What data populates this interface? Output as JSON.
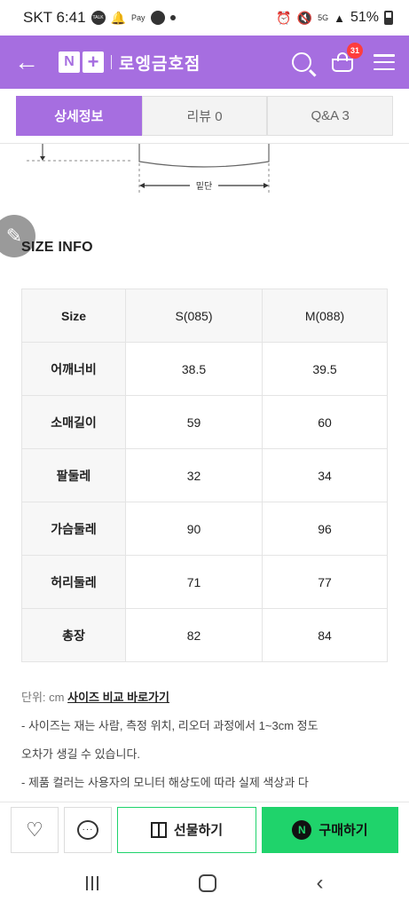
{
  "status_bar": {
    "carrier_time": "SKT 6:41",
    "talk_icon": "TALK",
    "pay_icon": "Pay",
    "network": "5G",
    "battery": "51%"
  },
  "header": {
    "logo_n": "N",
    "logo_plus": "+",
    "store_name": "로엥금호점",
    "cart_count": "31",
    "colors": {
      "brand": "#a66ee0",
      "badge": "#ff3d3d"
    }
  },
  "tabs": [
    {
      "label": "상세정보",
      "active": true
    },
    {
      "label": "리뷰 0",
      "active": false
    },
    {
      "label": "Q&A 3",
      "active": false
    }
  ],
  "diagram": {
    "label": "밑단"
  },
  "size_info": {
    "title": "SIZE INFO",
    "headers": [
      "Size",
      "S(085)",
      "M(088)"
    ],
    "rows": [
      {
        "name": "어깨너비",
        "s": "38.5",
        "m": "39.5"
      },
      {
        "name": "소매길이",
        "s": "59",
        "m": "60"
      },
      {
        "name": "팔둘레",
        "s": "32",
        "m": "34"
      },
      {
        "name": "가슴둘레",
        "s": "90",
        "m": "96"
      },
      {
        "name": "허리둘레",
        "s": "71",
        "m": "77"
      },
      {
        "name": "총장",
        "s": "82",
        "m": "84"
      }
    ]
  },
  "notes": {
    "unit_label": "단위: cm",
    "compare_link": "사이즈 비교 바로가기",
    "line1": "- 사이즈는 재는 사람, 측정 위치, 리오더 과정에서 1~3cm 정도",
    "line2": "오차가 생길 수 있습니다.",
    "line3": "- 제품 컬러는 사용자의 모니터 해상도에 따라 실제 색상과 다"
  },
  "bottom_bar": {
    "gift_label": "선물하기",
    "buy_label": "구매하기",
    "npay_mark": "N",
    "talk_icon_text": "···",
    "colors": {
      "naver_green": "#1fd36b"
    }
  }
}
